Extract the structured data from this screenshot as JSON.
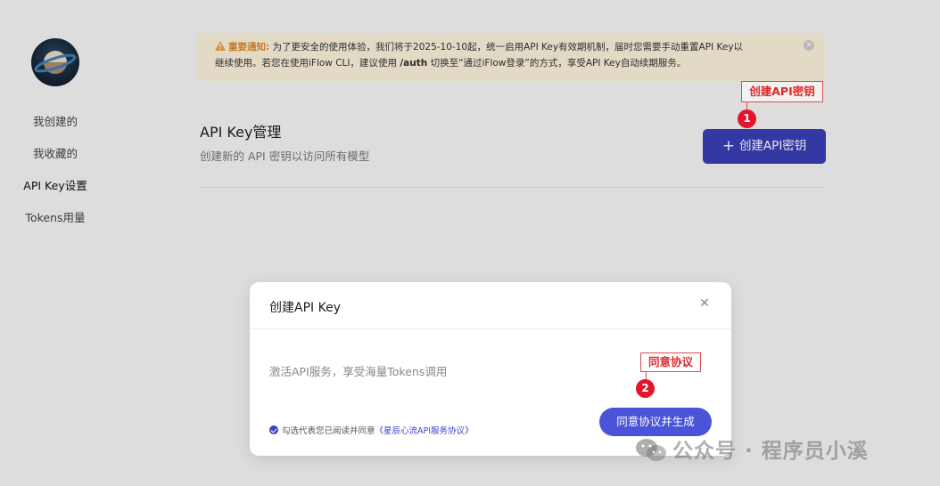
{
  "sidebar": {
    "items": [
      {
        "label": "我创建的"
      },
      {
        "label": "我收藏的"
      },
      {
        "label": "API Key设置"
      },
      {
        "label": "Tokens用量"
      }
    ]
  },
  "notice": {
    "prefix": "重要通知:",
    "text1": "为了更安全的使用体验，我们将于2025-10-10起，统一启用API Key有效期机制，届时您需要手动重置API Key以",
    "text2a": "继续使用。若您在使用iFlow CLI，建议使用 ",
    "code": "/auth",
    "text2b": " 切换至“通过iFlow登录”的方式，享受API Key自动续期服务。"
  },
  "section": {
    "title": "API Key管理",
    "subtitle": "创建新的 API 密钥以访问所有模型",
    "create_button": "创建API密钥"
  },
  "annotations": {
    "a1_label": "创建API密钥",
    "a1_num": "1",
    "a2_label": "同意协议",
    "a2_num": "2"
  },
  "modal": {
    "title": "创建API Key",
    "description": "激活API服务，享受海量Tokens调用",
    "agree_prefix": "勾选代表您已阅读并同意",
    "agree_link": "《星辰心流API服务协议》",
    "confirm_button": "同意协议并生成"
  },
  "watermark": "公众号 · 程序员小溪",
  "colors": {
    "primary": "#3a3fb6",
    "modal_button": "#4a54d8",
    "notice_bg": "#fdf3dd",
    "annotation": "#e5142c"
  }
}
